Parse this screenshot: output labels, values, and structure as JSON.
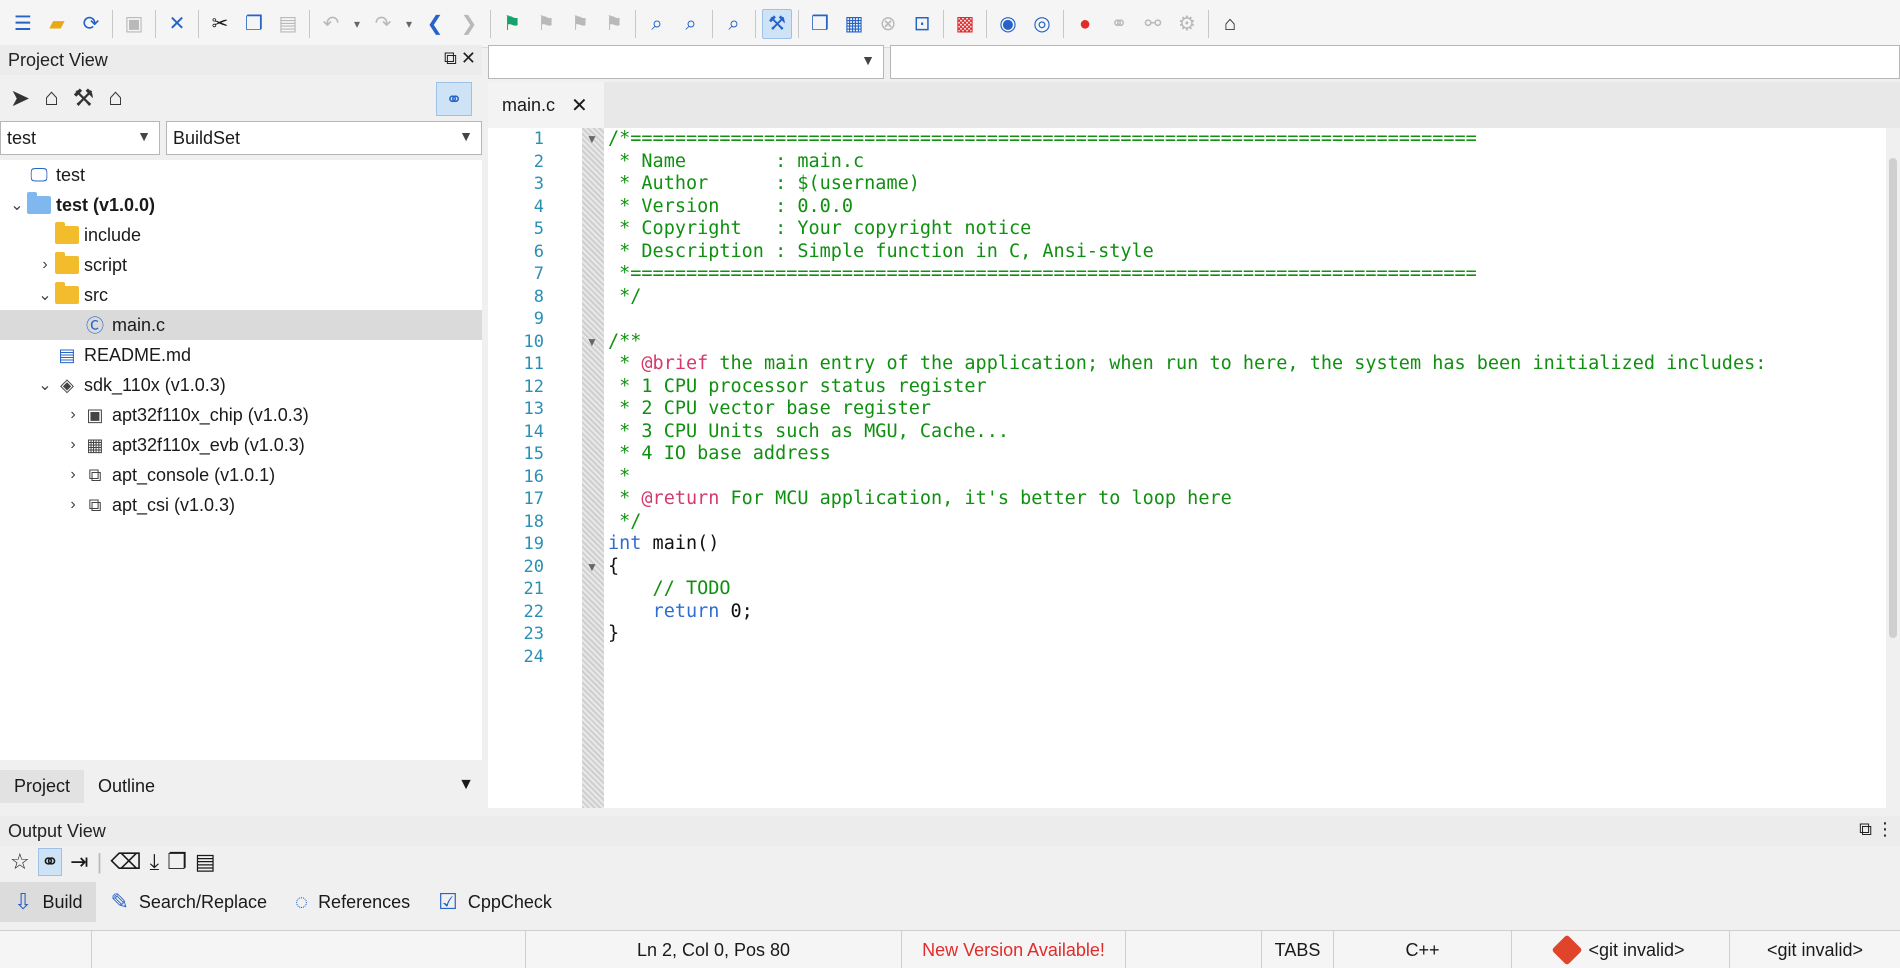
{
  "toolbar": {
    "icons": [
      "new-file-icon",
      "open-folder-icon",
      "refresh-icon",
      "save-icon",
      "close-icon",
      "cut-icon",
      "copy-icon",
      "paste-icon",
      "undo-icon",
      "undo-dropdown-icon",
      "redo-icon",
      "redo-dropdown-icon",
      "back-icon",
      "forward-icon",
      "bookmark-icon",
      "prev-bookmark-icon",
      "next-bookmark-icon",
      "clear-bookmark-icon",
      "find-icon",
      "find-in-files-icon",
      "find-symbol-icon",
      "build-mode-icon",
      "build-icon",
      "rebuild-icon",
      "stop-icon",
      "clean-icon",
      "load-icon",
      "debug-icon",
      "debug-step-icon",
      "breakpoint-icon",
      "connect-icon",
      "disconnect-icon",
      "settings-icon",
      "home-icon"
    ]
  },
  "project_view": {
    "title": "Project View",
    "project_select": "test",
    "buildset_select": "BuildSet",
    "tree": [
      {
        "label": "test",
        "indent": 0,
        "expander": "",
        "icon": "monitor-icon",
        "bold": false
      },
      {
        "label": "test (v1.0.0)",
        "indent": 0,
        "expander": "v",
        "icon": "project-folder-icon",
        "bold": true
      },
      {
        "label": "include",
        "indent": 1,
        "expander": "",
        "icon": "folder-icon",
        "bold": false
      },
      {
        "label": "script",
        "indent": 1,
        "expander": ">",
        "icon": "folder-icon",
        "bold": false
      },
      {
        "label": "src",
        "indent": 1,
        "expander": "v",
        "icon": "folder-icon",
        "bold": false
      },
      {
        "label": "main.c",
        "indent": 2,
        "expander": "",
        "icon": "c-file-icon",
        "bold": false,
        "selected": true
      },
      {
        "label": "README.md",
        "indent": 1,
        "expander": "",
        "icon": "doc-icon",
        "bold": false
      },
      {
        "label": "sdk_110x (v1.0.3)",
        "indent": 1,
        "expander": "v",
        "icon": "sdk-icon",
        "bold": false
      },
      {
        "label": "apt32f110x_chip (v1.0.3)",
        "indent": 2,
        "expander": ">",
        "icon": "chip-icon",
        "bold": false
      },
      {
        "label": "apt32f110x_evb (v1.0.3)",
        "indent": 2,
        "expander": ">",
        "icon": "board-icon",
        "bold": false
      },
      {
        "label": "apt_console (v1.0.1)",
        "indent": 2,
        "expander": ">",
        "icon": "component-icon",
        "bold": false
      },
      {
        "label": "apt_csi (v1.0.3)",
        "indent": 2,
        "expander": ">",
        "icon": "component-icon",
        "bold": false
      }
    ],
    "bottom_tabs": [
      "Project",
      "Outline"
    ]
  },
  "editor": {
    "tab_label": "main.c",
    "lines": [
      [
        {
          "c": "cmt",
          "t": "/*============================================================================"
        }
      ],
      [
        {
          "c": "cmt",
          "t": " * Name        : main.c"
        }
      ],
      [
        {
          "c": "cmt",
          "t": " * Author      : $(username)"
        }
      ],
      [
        {
          "c": "cmt",
          "t": " * Version     : 0.0.0"
        }
      ],
      [
        {
          "c": "cmt",
          "t": " * Copyright   : Your copyright notice"
        }
      ],
      [
        {
          "c": "cmt",
          "t": " * Description : Simple function in C, Ansi-style"
        }
      ],
      [
        {
          "c": "cmt",
          "t": " *============================================================================"
        }
      ],
      [
        {
          "c": "cmt",
          "t": " */"
        }
      ],
      [],
      [
        {
          "c": "cmt",
          "t": "/**"
        }
      ],
      [
        {
          "c": "cmt",
          "t": " * "
        },
        {
          "c": "tag",
          "t": "@brief"
        },
        {
          "c": "cmt",
          "t": " the main entry of the application; when run to here, the system has been initialized includes:"
        }
      ],
      [
        {
          "c": "cmt",
          "t": " * 1 CPU processor status register"
        }
      ],
      [
        {
          "c": "cmt",
          "t": " * 2 CPU vector base register"
        }
      ],
      [
        {
          "c": "cmt",
          "t": " * 3 CPU Units such as MGU, Cache..."
        }
      ],
      [
        {
          "c": "cmt",
          "t": " * 4 IO base address"
        }
      ],
      [
        {
          "c": "cmt",
          "t": " *"
        }
      ],
      [
        {
          "c": "cmt",
          "t": " * "
        },
        {
          "c": "tag",
          "t": "@return"
        },
        {
          "c": "cmt",
          "t": " For MCU application, it's better to loop here"
        }
      ],
      [
        {
          "c": "cmt",
          "t": " */"
        }
      ],
      [
        {
          "c": "kw",
          "t": "int"
        },
        {
          "c": "plain",
          "t": " main()"
        }
      ],
      [
        {
          "c": "plain",
          "t": "{"
        }
      ],
      [
        {
          "c": "cmt",
          "t": "    // TODO"
        }
      ],
      [
        {
          "c": "plain",
          "t": "    "
        },
        {
          "c": "kw",
          "t": "return"
        },
        {
          "c": "plain",
          "t": " 0;"
        }
      ],
      [
        {
          "c": "plain",
          "t": "}"
        }
      ],
      []
    ]
  },
  "output_view": {
    "title": "Output View",
    "tabs": [
      {
        "label": "Build",
        "icon": "build-arrow-icon"
      },
      {
        "label": "Search/Replace",
        "icon": "pencil-icon"
      },
      {
        "label": "References",
        "icon": "circle-icon"
      },
      {
        "label": "CppCheck",
        "icon": "checkbox-icon"
      }
    ]
  },
  "statusbar": {
    "position": "Ln 2, Col 0, Pos 80",
    "new_version": "New Version Available!",
    "tabs": "TABS",
    "language": "C++",
    "git1": "<git invalid>",
    "git2": "<git invalid>"
  }
}
